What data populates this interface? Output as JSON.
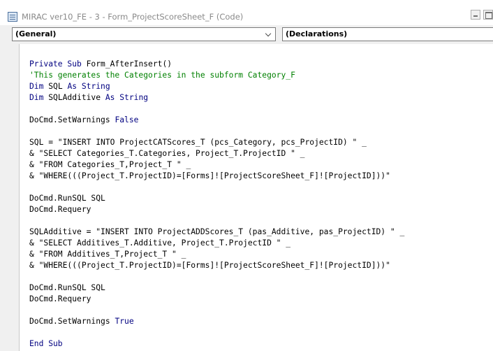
{
  "window": {
    "title": "MIRAC ver10_FE - 3 - Form_ProjectScoreSheet_F (Code)"
  },
  "toolbar": {
    "object_combo": "(General)",
    "procedure_combo": "(Declarations)"
  },
  "colors": {
    "keyword": "#000080",
    "comment": "#008000",
    "text": "#000000",
    "toolbar_bg": "#f0f0f0"
  },
  "icons": {
    "title": "module-icon",
    "minimize": "minimize-icon",
    "maximize": "maximize-icon",
    "dropdown": "chevron-down-icon"
  },
  "code": {
    "lines": [
      [
        [
          "k",
          "Private Sub "
        ],
        [
          "t",
          "Form_AfterInsert()"
        ]
      ],
      [
        [
          "c",
          "'This generates the Categories in the subform Category_F"
        ]
      ],
      [
        [
          "k",
          "Dim "
        ],
        [
          "t",
          "SQL "
        ],
        [
          "k",
          "As String"
        ]
      ],
      [
        [
          "k",
          "Dim "
        ],
        [
          "t",
          "SQLAdditive "
        ],
        [
          "k",
          "As String"
        ]
      ],
      [],
      [
        [
          "t",
          "DoCmd.SetWarnings "
        ],
        [
          "k",
          "False"
        ]
      ],
      [],
      [
        [
          "t",
          "SQL = \"INSERT INTO ProjectCATScores_T (pcs_Category, pcs_ProjectID) \" _"
        ]
      ],
      [
        [
          "t",
          "& \"SELECT Categories_T.Categories, Project_T.ProjectID \" _"
        ]
      ],
      [
        [
          "t",
          "& \"FROM Categories_T,Project_T \" _"
        ]
      ],
      [
        [
          "t",
          "& \"WHERE(((Project_T.ProjectID)=[Forms]![ProjectScoreSheet_F]![ProjectID]))\""
        ]
      ],
      [],
      [
        [
          "t",
          "DoCmd.RunSQL SQL"
        ]
      ],
      [
        [
          "t",
          "DoCmd.Requery"
        ]
      ],
      [],
      [
        [
          "t",
          "SQLAdditive = \"INSERT INTO ProjectADDScores_T (pas_Additive, pas_ProjectID) \" _"
        ]
      ],
      [
        [
          "t",
          "& \"SELECT Additives_T.Additive, Project_T.ProjectID \" _"
        ]
      ],
      [
        [
          "t",
          "& \"FROM Additives_T,Project_T \" _"
        ]
      ],
      [
        [
          "t",
          "& \"WHERE(((Project_T.ProjectID)=[Forms]![ProjectScoreSheet_F]![ProjectID]))\""
        ]
      ],
      [],
      [
        [
          "t",
          "DoCmd.RunSQL SQL"
        ]
      ],
      [
        [
          "t",
          "DoCmd.Requery"
        ]
      ],
      [],
      [
        [
          "t",
          "DoCmd.SetWarnings "
        ],
        [
          "k",
          "True"
        ]
      ],
      [],
      [
        [
          "k",
          "End Sub"
        ]
      ]
    ]
  }
}
